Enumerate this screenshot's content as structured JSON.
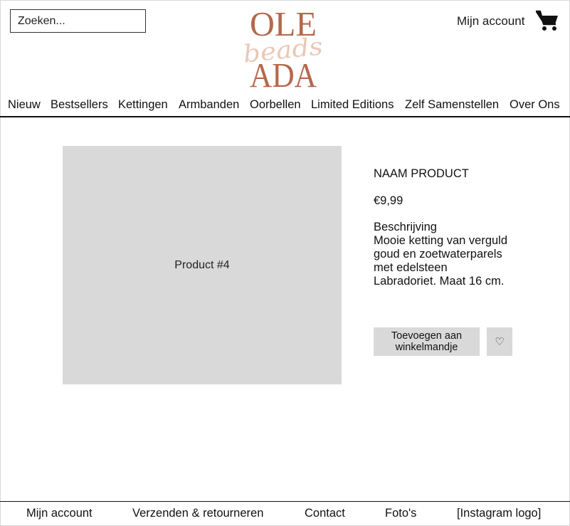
{
  "header": {
    "search_placeholder": "Zoeken...",
    "logo": {
      "line1": "OLE",
      "script": "beads",
      "line2": "ADA",
      "color": "#b4684a",
      "script_color": "#e9c9b6"
    },
    "account_label": "Mijn account",
    "cart_icon": "shopping-cart-icon"
  },
  "nav": {
    "items": [
      "Nieuw",
      "Bestsellers",
      "Kettingen",
      "Armbanden",
      "Oorbellen",
      "Limited Editions",
      "Zelf Samenstellen",
      "Over Ons"
    ]
  },
  "product": {
    "image_label": "Product #4",
    "name": "NAAM PRODUCT",
    "price": "€9,99",
    "description_heading": "Beschrijving",
    "description": "Mooie ketting van verguld\ngoud   en zoetwaterparels\nmet edelsteen\nLabradoriet. Maat 16 cm.",
    "add_to_cart_label": "Toevoegen aan winkelmandje",
    "wishlist_icon": "♡"
  },
  "footer": {
    "items": [
      "Mijn account",
      "Verzenden & retourneren",
      "Contact",
      "Foto's",
      "[Instagram logo]"
    ]
  }
}
